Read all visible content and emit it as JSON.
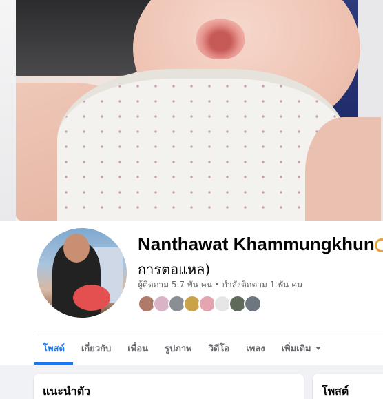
{
  "profile": {
    "name": "Nanthawat Khammungkhun",
    "nickname": "การตอแหล)",
    "followers_text": "ผู้ติดตาม 5.7 พัน คน • กำลังติดตาม 1 พัน คน"
  },
  "friends_preview": [
    {
      "color": "#b07a6a"
    },
    {
      "color": "#d9b3c8"
    },
    {
      "color": "#8a8f96"
    },
    {
      "color": "#c9a24a"
    },
    {
      "color": "#e4a5b0"
    },
    {
      "color": "#e6e6e6"
    },
    {
      "color": "#5e6a5a"
    },
    {
      "color": "#6e7680"
    }
  ],
  "tabs": [
    {
      "label": "โพสต์",
      "active": true
    },
    {
      "label": "เกี่ยวกับ"
    },
    {
      "label": "เพื่อน"
    },
    {
      "label": "รูปภาพ"
    },
    {
      "label": "วิดีโอ"
    },
    {
      "label": "เพลง"
    },
    {
      "label": "เพิ่มเติม"
    }
  ],
  "cards": {
    "intro_title": "แนะนำตัว",
    "posts_title": "โพสต์"
  },
  "colors": {
    "accent": "#1877f2",
    "text_primary": "#050505",
    "text_secondary": "#65676b"
  }
}
